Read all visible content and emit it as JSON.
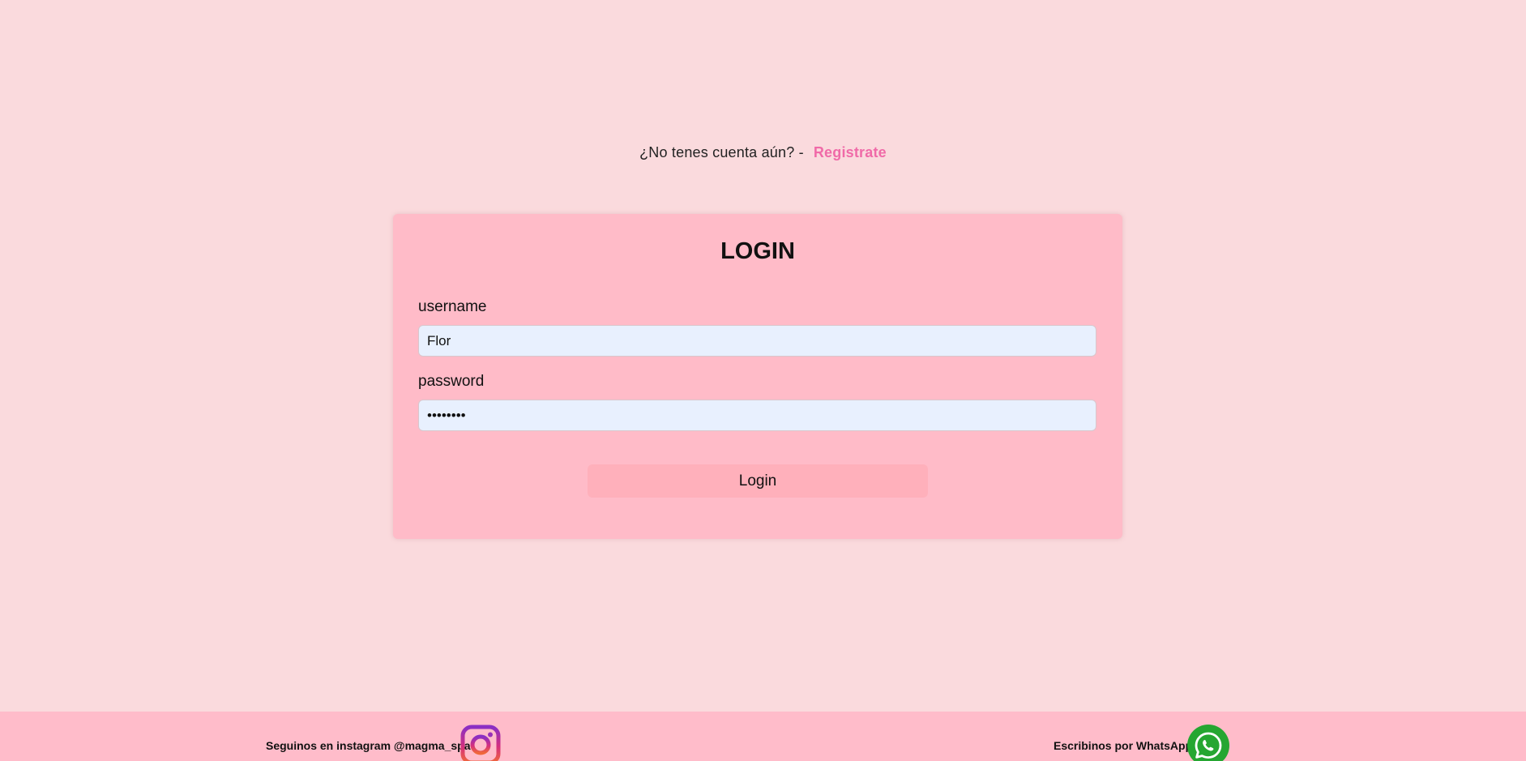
{
  "register": {
    "prompt": "¿No tenes cuenta aún? -",
    "link_label": "Registrate"
  },
  "login": {
    "title": "LOGIN",
    "username_label": "username",
    "username_value": "Flor",
    "password_label": "password",
    "password_value": "••••••••",
    "button_label": "Login"
  },
  "footer": {
    "instagram_text": "Seguinos en instagram @magma_spa",
    "instagram_icon": "instagram-icon",
    "whatsapp_text": "Escribinos por WhatsApp",
    "whatsapp_icon": "whatsapp-icon"
  },
  "colors": {
    "page_background": "#fadadd",
    "card_background": "#ffbbc8",
    "accent_link": "#f06aa8",
    "input_background": "#e8f0fe",
    "button_background": "#ffb0bb",
    "footer_background": "#ffbcca",
    "whatsapp_green": "#25a631"
  }
}
